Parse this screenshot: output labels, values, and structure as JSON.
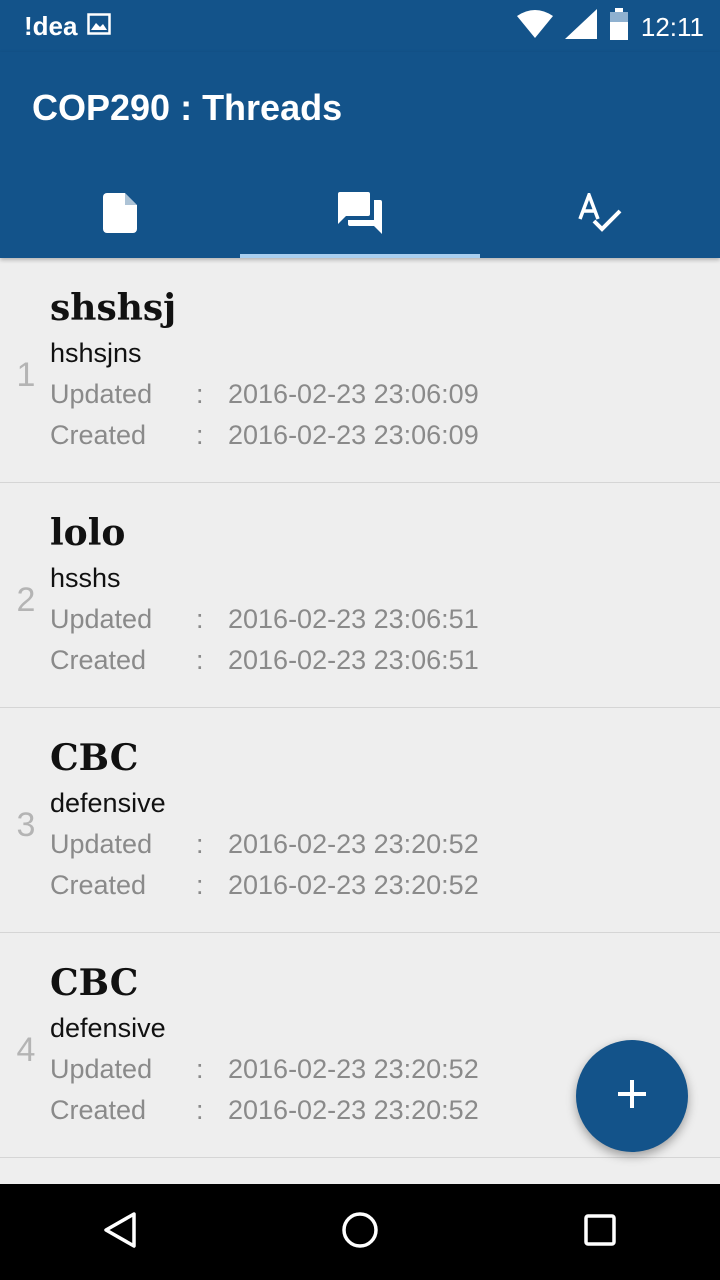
{
  "status_bar": {
    "carrier": "!dea",
    "time": "12:11",
    "icons": [
      "image-icon",
      "wifi-icon",
      "signal-icon",
      "battery-icon"
    ]
  },
  "app_bar": {
    "title": "COP290 : Threads",
    "tabs": [
      {
        "icon": "document-icon",
        "selected": false
      },
      {
        "icon": "forum-icon",
        "selected": true
      },
      {
        "icon": "spellcheck-icon",
        "selected": false
      }
    ]
  },
  "threads": [
    {
      "index": "1",
      "title": "shshsj",
      "subtitle": "hshsjns",
      "updated_label": "Updated",
      "updated": "2016-02-23 23:06:09",
      "created_label": "Created",
      "created": "2016-02-23 23:06:09",
      "sep": ":"
    },
    {
      "index": "2",
      "title": "lolo",
      "subtitle": "hsshs",
      "updated_label": "Updated",
      "updated": "2016-02-23 23:06:51",
      "created_label": "Created",
      "created": "2016-02-23 23:06:51",
      "sep": ":"
    },
    {
      "index": "3",
      "title": "CBC",
      "subtitle": "defensive",
      "updated_label": "Updated",
      "updated": "2016-02-23 23:20:52",
      "created_label": "Created",
      "created": "2016-02-23 23:20:52",
      "sep": ":"
    },
    {
      "index": "4",
      "title": "CBC",
      "subtitle": "defensive",
      "updated_label": "Updated",
      "updated": "2016-02-23 23:20:52",
      "created_label": "Created",
      "created": "2016-02-23 23:20:52",
      "sep": ":"
    }
  ],
  "fab": {
    "icon": "plus-icon"
  },
  "nav": [
    "back-icon",
    "home-icon",
    "recents-icon"
  ],
  "colors": {
    "primary": "#13538a",
    "background": "#eeeeee",
    "tab_indicator": "#a9cff0"
  }
}
